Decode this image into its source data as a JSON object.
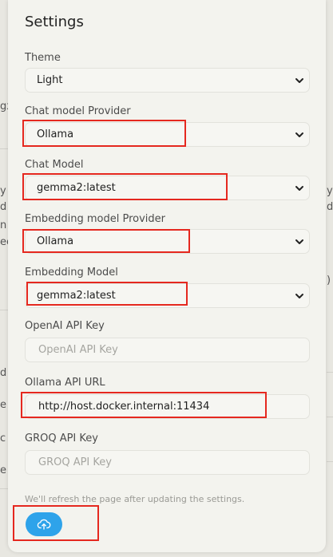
{
  "background": {
    "fragments": [
      "gx",
      "y",
      "d",
      "n",
      "y",
      "ec",
      "d",
      ")",
      "d",
      "e",
      "c",
      "e"
    ]
  },
  "settings": {
    "title": "Settings",
    "theme": {
      "label": "Theme",
      "value": "Light"
    },
    "chat_provider": {
      "label": "Chat model Provider",
      "value": "Ollama"
    },
    "chat_model": {
      "label": "Chat Model",
      "value": "gemma2:latest"
    },
    "embedding_provider": {
      "label": "Embedding model Provider",
      "value": "Ollama"
    },
    "embedding_model": {
      "label": "Embedding Model",
      "value": "gemma2:latest"
    },
    "openai_key": {
      "label": "OpenAI API Key",
      "placeholder": "OpenAI API Key",
      "value": ""
    },
    "ollama_url": {
      "label": "Ollama API URL",
      "value": "http://host.docker.internal:11434"
    },
    "groq_key": {
      "label": "GROQ API Key",
      "placeholder": "GROQ API Key",
      "value": ""
    },
    "note": "We'll refresh the page after updating the settings.",
    "save_icon": "cloud-upload-icon"
  },
  "colors": {
    "accent": "#2ea3ea",
    "highlight": "#e5281f"
  }
}
